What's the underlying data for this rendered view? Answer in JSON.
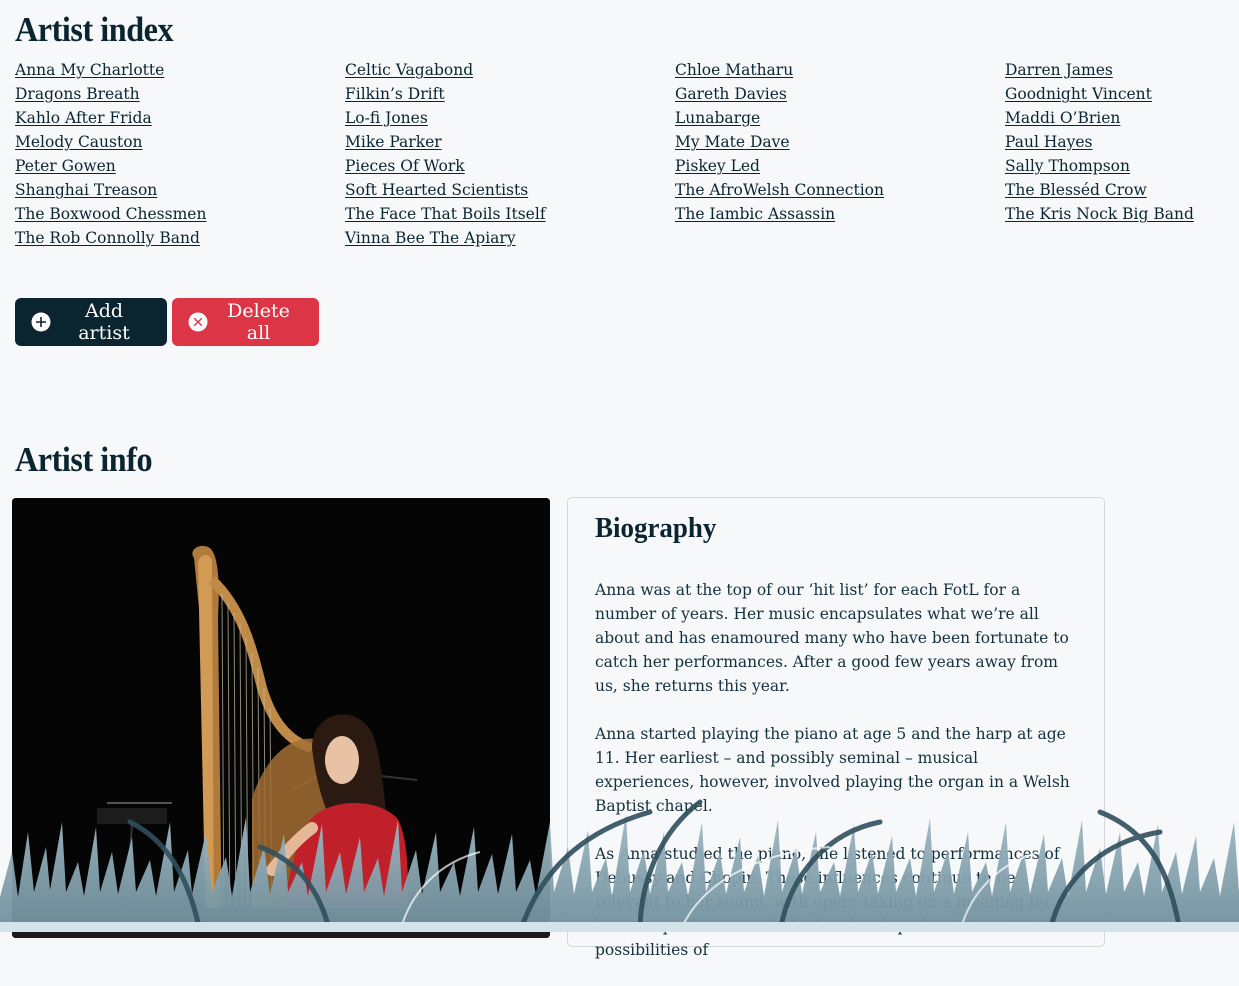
{
  "artist_index": {
    "title": "Artist index",
    "artists": [
      "Anna My Charlotte",
      "Celtic Vagabond",
      "Chloe Matharu",
      "Darren James",
      "Dragons Breath",
      "Filkin’s Drift",
      "Gareth Davies",
      "Goodnight Vincent",
      "Kahlo After Frida",
      "Lo-fi Jones",
      "Lunabarge",
      "Maddi O’Brien",
      "Melody Causton",
      "Mike Parker",
      "My Mate Dave",
      "Paul Hayes",
      "Peter Gowen",
      "Pieces Of Work",
      "Piskey Led",
      "Sally Thompson",
      "Shanghai Treason",
      "Soft Hearted Scientists",
      "The AfroWelsh Connection",
      "The Blesséd Crow",
      "The Boxwood Chessmen",
      "The Face That Boils Itself",
      "The Iambic Assassin",
      "The Kris Nock Big Band",
      "The Rob Connolly Band",
      "Vinna Bee The Apiary"
    ]
  },
  "actions": {
    "add_label": "Add artist",
    "delete_label": "Delete all",
    "add_icon": "plus-circle-icon",
    "delete_icon": "x-circle-icon"
  },
  "artist_info": {
    "title": "Artist info",
    "bio_title": "Biography",
    "bio_paragraphs": [
      "Anna was at the top of our ‘hit list’ for each FotL for a number of years. Her music encapsulates what we’re all about and has enamoured many who have been fortunate to catch her performances. After a good few years away from us, she returns this year.",
      "Anna started playing the piano at age 5 and the harp at age 11. Her earliest – and possibly seminal – musical experiences, however, involved playing the organ in a Welsh Baptist chapel.",
      "As Anna studied the piano, she listened to performances of Debussy and Chopin. These influences continue to be relevant to her sound, with opera taking on a meaning for her as a performer and she has developed an interest in the possibilities of"
    ]
  },
  "colors": {
    "primary": "#0b2530",
    "danger": "#dc3545",
    "background": "#f7f8fa",
    "grass": "#7f9eab"
  }
}
